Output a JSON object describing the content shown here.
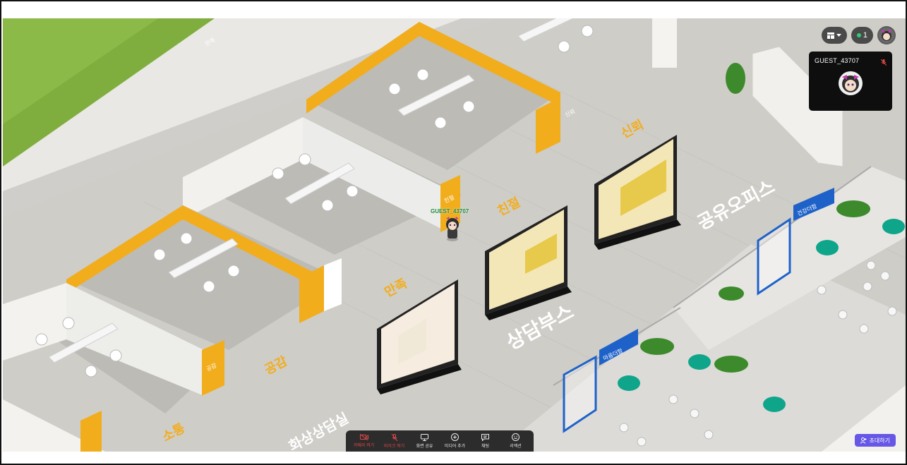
{
  "top_controls": {
    "layout_menu_icon": "layout-grid-icon",
    "participants_count": "1"
  },
  "participant_card": {
    "name": "GUEST_43707"
  },
  "avatar": {
    "name": "GUEST_43707"
  },
  "toolbar": {
    "items": [
      {
        "label": "카메라 켜기",
        "icon": "camera-off-icon",
        "state": "off"
      },
      {
        "label": "마이크 켜기",
        "icon": "mic-off-icon",
        "state": "off"
      },
      {
        "label": "화면 공유",
        "icon": "monitor-icon"
      },
      {
        "label": "미디어 추가",
        "icon": "plus-circle-icon"
      },
      {
        "label": "채팅",
        "icon": "chat-icon"
      },
      {
        "label": "리액션",
        "icon": "smile-icon"
      }
    ]
  },
  "invite_button": {
    "label": "초대하기",
    "icon": "user-plus-icon"
  },
  "colors": {
    "accent": "#6657e6",
    "wall_yellow": "#f2ad1c",
    "muted_red": "#e04848",
    "sign_blue": "#1e62c9"
  }
}
